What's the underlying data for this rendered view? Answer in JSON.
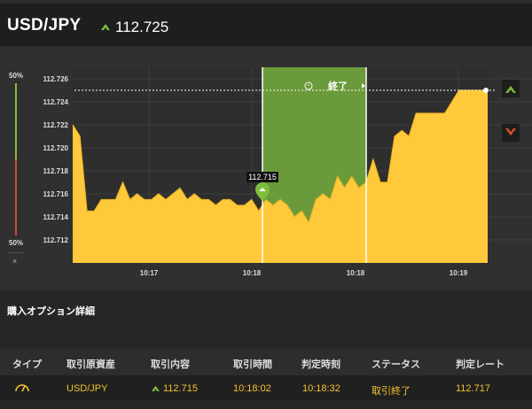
{
  "header": {
    "pair": "USD/JPY",
    "price": "112.725",
    "direction_icon": "up-arrow-icon",
    "up_color": "#7fbf3f"
  },
  "gauge": {
    "top_label": "50%",
    "bottom_label": "50%",
    "close_label": "×"
  },
  "chart_overlay": {
    "period_label": "終了",
    "marker_label": "112.715"
  },
  "chart_data": {
    "type": "area",
    "yticks": [
      "112.726",
      "112.724",
      "112.722",
      "112.720",
      "112.718",
      "112.716",
      "112.714",
      "112.712"
    ],
    "ylim": [
      112.71,
      112.727
    ],
    "xticks": [
      "10:17",
      "10:18",
      "10:18",
      "10:19"
    ],
    "current_rate": 112.725,
    "entry_rate": 112.715,
    "series": [
      {
        "values": [
          112.722,
          112.721,
          112.7145,
          112.7145,
          112.7155,
          112.7155,
          112.7155,
          112.717,
          112.7155,
          112.716,
          112.7155,
          112.7155,
          112.716,
          112.7155,
          112.716,
          112.7165,
          112.7155,
          112.716,
          112.7155,
          112.7155,
          112.715,
          112.7155,
          112.7155,
          112.715,
          112.715,
          112.7155,
          112.7145,
          112.7155,
          112.715,
          112.7155,
          112.715,
          112.714,
          112.7145,
          112.7135,
          112.7155,
          112.716,
          112.7155,
          112.7175,
          112.7165,
          112.7175,
          112.7165,
          112.717,
          112.719,
          112.717,
          112.717,
          112.721,
          112.7215,
          112.721,
          112.723,
          112.723,
          112.723,
          112.723,
          112.723,
          112.724,
          112.725,
          112.725,
          112.725,
          112.725,
          112.725
        ]
      }
    ],
    "colors": {
      "area": "#ffc93c",
      "area_top": "#f2b824",
      "grid": "#3e3e3e",
      "period": "#6a9a3a"
    }
  },
  "buttons": {
    "up_icon": "chevron-up-icon",
    "down_icon": "chevron-down-icon",
    "up_color": "#7fbf3f",
    "down_color": "#d9532c"
  },
  "section": {
    "title": "購入オプション詳細"
  },
  "table": {
    "headers": [
      "タイプ",
      "取引原資産",
      "取引内容",
      "取引時間",
      "判定時刻",
      "ステータス",
      "判定レート"
    ],
    "row": {
      "type_icon": "gauge-icon",
      "asset": "USD/JPY",
      "content": "112.715",
      "trade_time": "10:18:02",
      "judge_time": "10:18:32",
      "status": "取引終了",
      "judge_rate": "112.717"
    }
  }
}
